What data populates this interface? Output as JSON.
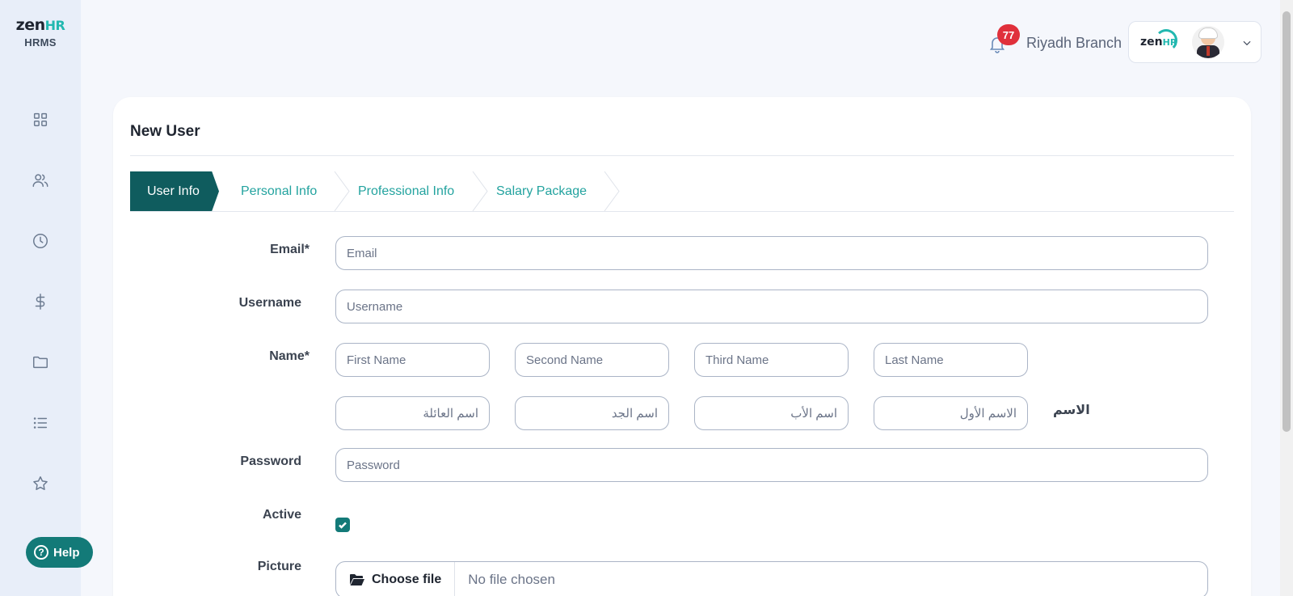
{
  "sidebar": {
    "logo_main": "zen",
    "logo_accent": "HR",
    "logo_sub": "HRMS",
    "nav_icons": [
      "dashboard-icon",
      "users-icon",
      "clock-icon",
      "dollar-icon",
      "folder-icon",
      "list-icon",
      "star-icon"
    ],
    "help_label": "Help"
  },
  "header": {
    "notification_count": "77",
    "branch": "Riyadh Branch",
    "account_logo_main": "zen",
    "account_logo_accent": "HR"
  },
  "form": {
    "title": "New User",
    "steps": [
      {
        "label": "User Info",
        "active": true
      },
      {
        "label": "Personal Info",
        "active": false
      },
      {
        "label": "Professional Info",
        "active": false
      },
      {
        "label": "Salary Package",
        "active": false
      }
    ],
    "email": {
      "label": "Email",
      "required": "*",
      "placeholder": "Email"
    },
    "username": {
      "label": "Username",
      "placeholder": "Username"
    },
    "name": {
      "label": "Name",
      "required": "*",
      "first": "First Name",
      "second": "Second Name",
      "third": "Third Name",
      "last": "Last Name",
      "ar_label": "الاسم",
      "ar_first": "الاسم الأول",
      "ar_father": "اسم الأب",
      "ar_grandfather": "اسم الجد",
      "ar_family": "اسم العائلة"
    },
    "password": {
      "label": "Password",
      "placeholder": "Password"
    },
    "active": {
      "label": "Active",
      "checked": true
    },
    "picture": {
      "label": "Picture",
      "button": "Choose file",
      "status": "No file chosen"
    }
  },
  "colors": {
    "accent": "#137a78",
    "step_active": "#0f5c5e",
    "step_text": "#23a39f",
    "badge": "#e0303b"
  }
}
